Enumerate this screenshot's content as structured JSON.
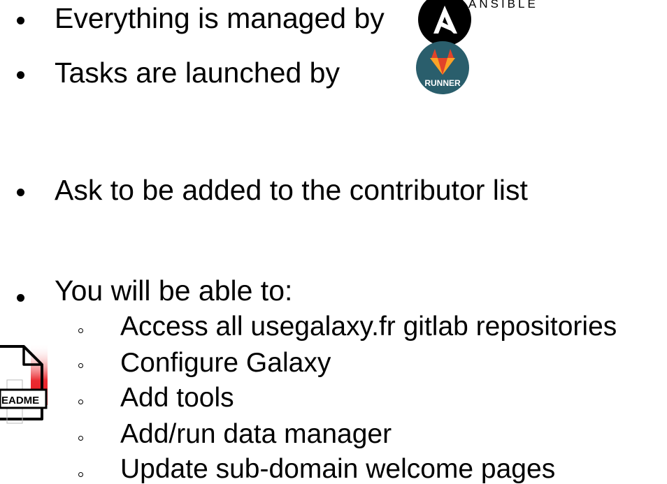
{
  "bullets": {
    "managed": "Everything is managed by",
    "launched": "Tasks are launched by",
    "ask": "Ask to be added to the contributor list",
    "able": "You will be able to:"
  },
  "sub_items": [
    "Access all usegalaxy.fr gitlab repositories",
    "Configure Galaxy",
    "Add tools",
    "Add/run data manager",
    "Update sub-domain welcome pages"
  ],
  "logos": {
    "ansible_text": "ANSIBLE",
    "runner_text": "RUNNER",
    "readme_text": "EADME"
  },
  "colors": {
    "text": "#000000",
    "ansible_bg": "#000000",
    "runner_bg": "#2a5e6c",
    "gitlab_orange": "#e24329",
    "gitlab_light": "#fca326",
    "readme_red": "#e8141b"
  }
}
